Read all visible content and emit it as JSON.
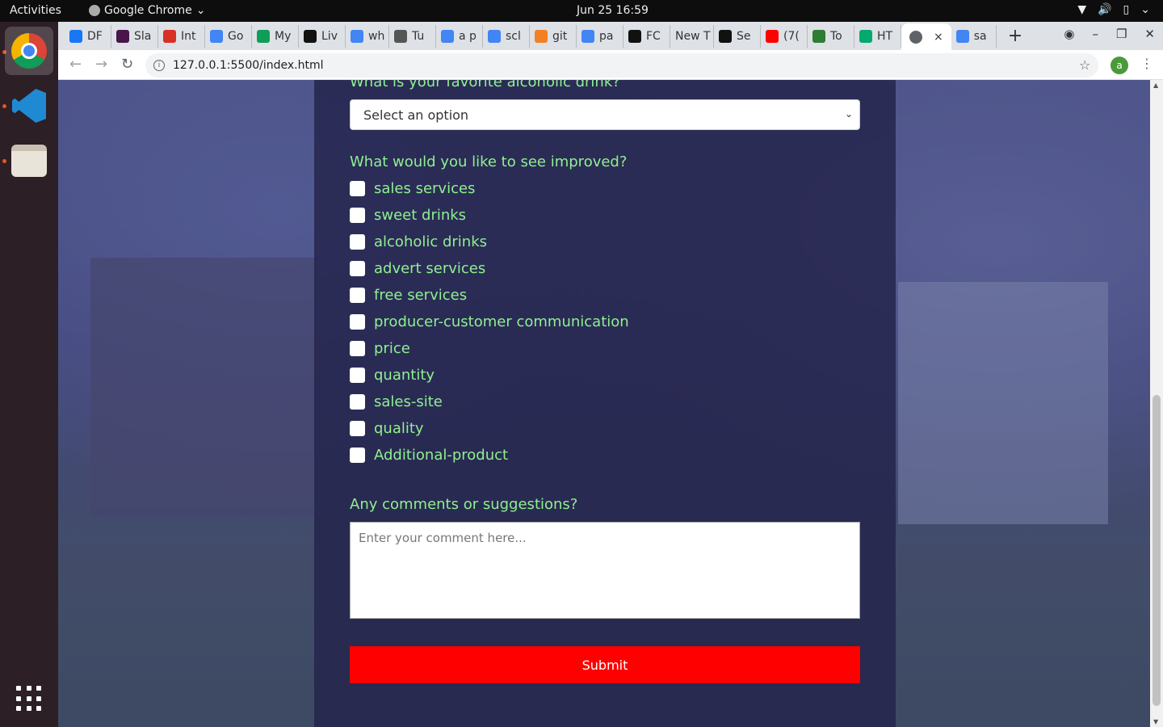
{
  "system": {
    "activities": "Activities",
    "app_name": "Google Chrome",
    "clock": "Jun 25  16:59"
  },
  "browser": {
    "tabs": [
      {
        "label": "DF",
        "icon": "facebook-icon",
        "color": "#1877f2"
      },
      {
        "label": "Sla",
        "icon": "slack-icon",
        "color": "#4a154b"
      },
      {
        "label": "Int",
        "icon": "gmail-icon",
        "color": "#d93025"
      },
      {
        "label": "Go",
        "icon": "google-icon",
        "color": "#4285f4"
      },
      {
        "label": "My",
        "icon": "drive-icon",
        "color": "#0f9d58"
      },
      {
        "label": "Liv",
        "icon": "live-icon",
        "color": "#111111"
      },
      {
        "label": "wh",
        "icon": "google-icon",
        "color": "#4285f4"
      },
      {
        "label": "Tu",
        "icon": "wikipedia-icon",
        "color": "#555555"
      },
      {
        "label": "a p",
        "icon": "google-icon",
        "color": "#4285f4"
      },
      {
        "label": "scl",
        "icon": "google-icon",
        "color": "#4285f4"
      },
      {
        "label": "git",
        "icon": "stackoverflow-icon",
        "color": "#f48024"
      },
      {
        "label": "pa",
        "icon": "google-icon",
        "color": "#4285f4"
      },
      {
        "label": "FC",
        "icon": "codepen-icon",
        "color": "#111111"
      },
      {
        "label": "New T",
        "icon": "",
        "color": ""
      },
      {
        "label": "Se",
        "icon": "github-icon",
        "color": "#111111"
      },
      {
        "label": "(7(",
        "icon": "youtube-icon",
        "color": "#ff0000"
      },
      {
        "label": "To",
        "icon": "link-icon",
        "color": "#2e7d32"
      },
      {
        "label": "HT",
        "icon": "w3schools-icon",
        "color": "#04aa6d"
      }
    ],
    "active_tab_close": "×",
    "last_tab": {
      "label": "sa",
      "icon": "google-icon",
      "color": "#4285f4"
    },
    "url": "127.0.0.1:5500/index.html",
    "avatar_letter": "a"
  },
  "form": {
    "drink_question": "What is your favorite alcoholic drink?",
    "drink_select_value": "Select an option",
    "improve_question": "What would you like to see improved?",
    "improve_options": [
      "sales services",
      "sweet drinks",
      "alcoholic drinks",
      "advert services",
      "free services",
      "producer-customer communication",
      "price",
      "quantity",
      "sales-site",
      "quality",
      "Additional-product"
    ],
    "comments_question": "Any comments or suggestions?",
    "comments_placeholder": "Enter your comment here...",
    "submit_label": "Submit"
  }
}
